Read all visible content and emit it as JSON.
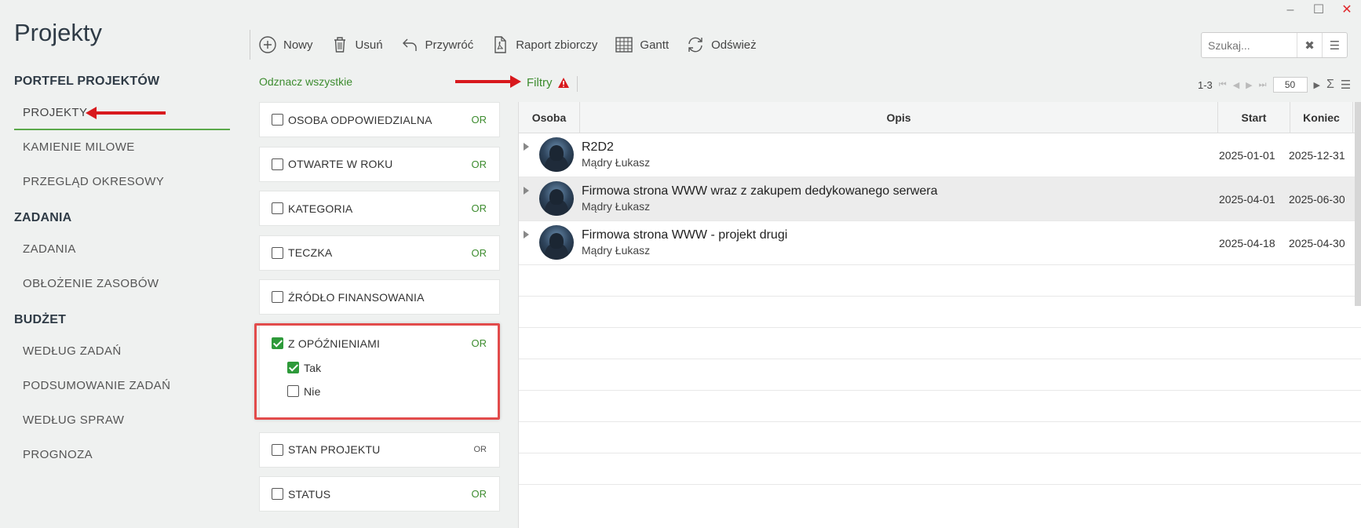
{
  "window": {
    "minimize": "–",
    "maximize": "☐",
    "close": "✕"
  },
  "app_title": "Projekty",
  "nav": {
    "sections": [
      {
        "title": "PORTFEL PROJEKTÓW",
        "items": [
          "PROJEKTY",
          "KAMIENIE MILOWE",
          "PRZEGLĄD OKRESOWY"
        ]
      },
      {
        "title": "ZADANIA",
        "items": [
          "ZADANIA",
          "OBŁOŻENIE ZASOBÓW"
        ]
      },
      {
        "title": "BUDŻET",
        "items": [
          "WEDŁUG ZADAŃ",
          "PODSUMOWANIE ZADAŃ",
          "WEDŁUG SPRAW",
          "PROGNOZA"
        ]
      }
    ],
    "active": "PROJEKTY"
  },
  "toolbar": {
    "new": "Nowy",
    "delete": "Usuń",
    "restore": "Przywróć",
    "report": "Raport zbiorczy",
    "gantt": "Gantt",
    "refresh": "Odśwież"
  },
  "search": {
    "placeholder": "Szukaj..."
  },
  "filters_header": {
    "unselect_all": "Odznacz wszystkie",
    "filters": "Filtry"
  },
  "filters": {
    "or": "OR",
    "items": [
      {
        "label": "OSOBA ODPOWIEDZIALNA",
        "checked": false,
        "or": "OR"
      },
      {
        "label": "OTWARTE W ROKU",
        "checked": false,
        "or": "OR"
      },
      {
        "label": "KATEGORIA",
        "checked": false,
        "or": "OR"
      },
      {
        "label": "TECZKA",
        "checked": false,
        "or": "OR"
      },
      {
        "label": "ŹRÓDŁO FINANSOWANIA",
        "checked": false,
        "or": ""
      }
    ],
    "delayed": {
      "label": "Z OPÓŹNIENIAMI",
      "checked": true,
      "or": "OR",
      "opt_yes": "Tak",
      "opt_no": "Nie"
    },
    "project_state": {
      "label": "STAN PROJEKTU",
      "or": "OR"
    },
    "status": {
      "label": "STATUS",
      "or": "OR"
    }
  },
  "pager": {
    "range": "1-3",
    "page_size": "50"
  },
  "grid": {
    "columns": {
      "person": "Osoba",
      "description": "Opis",
      "start": "Start",
      "end": "Koniec"
    },
    "rows": [
      {
        "title": "R2D2",
        "person": "Mądry Łukasz",
        "start": "2025-01-01",
        "end": "2025-12-31"
      },
      {
        "title": "Firmowa strona WWW wraz z zakupem dedykowanego serwera",
        "person": "Mądry Łukasz",
        "start": "2025-04-01",
        "end": "2025-06-30"
      },
      {
        "title": "Firmowa strona WWW - projekt drugi",
        "person": "Mądry Łukasz",
        "start": "2025-04-18",
        "end": "2025-04-30"
      }
    ]
  },
  "colors": {
    "accent_green": "#3d8c2f",
    "check_green": "#2e9a3a",
    "annotation_red": "#d8191d"
  }
}
